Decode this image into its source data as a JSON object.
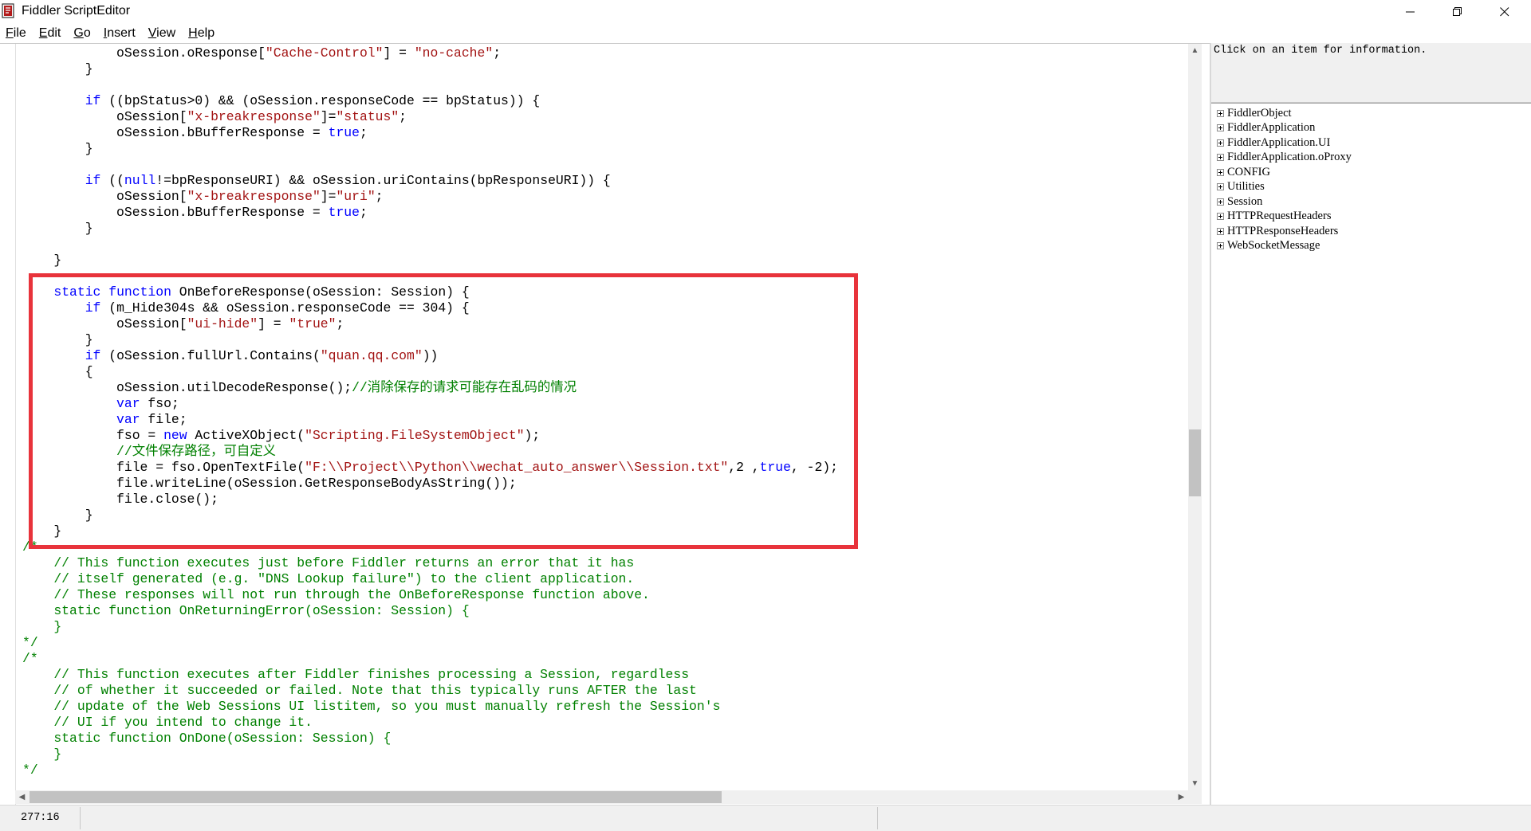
{
  "window": {
    "title": "Fiddler ScriptEditor",
    "minimize": "—",
    "maximize": "❐",
    "close": "✕"
  },
  "menu": [
    {
      "mnemonic": "F",
      "rest": "ile"
    },
    {
      "mnemonic": "E",
      "rest": "dit"
    },
    {
      "mnemonic": "G",
      "rest": "o"
    },
    {
      "mnemonic": "I",
      "rest": "nsert"
    },
    {
      "mnemonic": "V",
      "rest": "iew"
    },
    {
      "mnemonic": "H",
      "rest": "elp"
    }
  ],
  "editor": {
    "lines": [
      [
        [
          "            oSession.oResponse[",
          ""
        ],
        [
          "\"Cache-Control\"",
          "str"
        ],
        [
          "] = ",
          ""
        ],
        [
          "\"no-cache\"",
          "str"
        ],
        [
          ";",
          ""
        ]
      ],
      [
        [
          "        }",
          ""
        ]
      ],
      [
        [
          "",
          ""
        ]
      ],
      [
        [
          "        ",
          ""
        ],
        [
          "if",
          "kw"
        ],
        [
          " ((bpStatus>0) && (oSession.responseCode == bpStatus)) {",
          ""
        ]
      ],
      [
        [
          "            oSession[",
          ""
        ],
        [
          "\"x-breakresponse\"",
          "str"
        ],
        [
          "]=",
          ""
        ],
        [
          "\"status\"",
          "str"
        ],
        [
          ";",
          ""
        ]
      ],
      [
        [
          "            oSession.bBufferResponse = ",
          ""
        ],
        [
          "true",
          "kw"
        ],
        [
          ";",
          ""
        ]
      ],
      [
        [
          "        }",
          ""
        ]
      ],
      [
        [
          "",
          ""
        ]
      ],
      [
        [
          "        ",
          ""
        ],
        [
          "if",
          "kw"
        ],
        [
          " ((",
          ""
        ],
        [
          "null",
          "kw"
        ],
        [
          "!=bpResponseURI) && oSession.uriContains(bpResponseURI)) {",
          ""
        ]
      ],
      [
        [
          "            oSession[",
          ""
        ],
        [
          "\"x-breakresponse\"",
          "str"
        ],
        [
          "]=",
          ""
        ],
        [
          "\"uri\"",
          "str"
        ],
        [
          ";",
          ""
        ]
      ],
      [
        [
          "            oSession.bBufferResponse = ",
          ""
        ],
        [
          "true",
          "kw"
        ],
        [
          ";",
          ""
        ]
      ],
      [
        [
          "        }",
          ""
        ]
      ],
      [
        [
          "",
          ""
        ]
      ],
      [
        [
          "    }",
          ""
        ]
      ],
      [
        [
          "",
          ""
        ]
      ],
      [
        [
          "    ",
          ""
        ],
        [
          "static",
          "kw"
        ],
        [
          " ",
          ""
        ],
        [
          "function",
          "kw"
        ],
        [
          " OnBeforeResponse(oSession: Session) {",
          ""
        ]
      ],
      [
        [
          "        ",
          ""
        ],
        [
          "if",
          "kw"
        ],
        [
          " (m_Hide304s && oSession.responseCode == 304) {",
          ""
        ]
      ],
      [
        [
          "            oSession[",
          ""
        ],
        [
          "\"ui-hide\"",
          "str"
        ],
        [
          "] = ",
          ""
        ],
        [
          "\"true\"",
          "str"
        ],
        [
          ";",
          ""
        ]
      ],
      [
        [
          "        }",
          ""
        ]
      ],
      [
        [
          "        ",
          ""
        ],
        [
          "if",
          "kw"
        ],
        [
          " (oSession.fullUrl.Contains(",
          ""
        ],
        [
          "\"quan.qq.com\"",
          "str"
        ],
        [
          "))",
          ""
        ]
      ],
      [
        [
          "        {",
          ""
        ]
      ],
      [
        [
          "            oSession.utilDecodeResponse();",
          ""
        ],
        [
          "//消除保存的请求可能存在乱码的情况",
          "cm"
        ]
      ],
      [
        [
          "            ",
          ""
        ],
        [
          "var",
          "kw"
        ],
        [
          " fso;",
          ""
        ]
      ],
      [
        [
          "            ",
          ""
        ],
        [
          "var",
          "kw"
        ],
        [
          " file;",
          ""
        ]
      ],
      [
        [
          "            fso = ",
          ""
        ],
        [
          "new",
          "kw"
        ],
        [
          " ActiveXObject(",
          ""
        ],
        [
          "\"Scripting.FileSystemObject\"",
          "str"
        ],
        [
          ");",
          ""
        ]
      ],
      [
        [
          "            ",
          ""
        ],
        [
          "//文件保存路径，可自定义",
          "cm"
        ]
      ],
      [
        [
          "            file = fso.OpenTextFile(",
          ""
        ],
        [
          "\"F:\\\\Project\\\\Python\\\\wechat_auto_answer\\\\Session.txt\"",
          "str"
        ],
        [
          ",2 ,",
          ""
        ],
        [
          "true",
          "kw"
        ],
        [
          ", -2);",
          ""
        ]
      ],
      [
        [
          "            file.writeLine(oSession.GetResponseBodyAsString());",
          ""
        ]
      ],
      [
        [
          "            file.close();",
          ""
        ]
      ],
      [
        [
          "        }",
          ""
        ]
      ],
      [
        [
          "    }",
          ""
        ]
      ],
      [
        [
          "/*",
          "cm"
        ]
      ],
      [
        [
          "    // This function executes just before Fiddler returns an error that it has",
          "cm"
        ]
      ],
      [
        [
          "    // itself generated (e.g. \"DNS Lookup failure\") to the client application.",
          "cm"
        ]
      ],
      [
        [
          "    // These responses will not run through the OnBeforeResponse function above.",
          "cm"
        ]
      ],
      [
        [
          "    static function OnReturningError(oSession: Session) {",
          "cm"
        ]
      ],
      [
        [
          "    }",
          "cm"
        ]
      ],
      [
        [
          "*/",
          "cm"
        ]
      ],
      [
        [
          "/*",
          "cm"
        ]
      ],
      [
        [
          "    // This function executes after Fiddler finishes processing a Session, regardless",
          "cm"
        ]
      ],
      [
        [
          "    // of whether it succeeded or failed. Note that this typically runs AFTER the last",
          "cm"
        ]
      ],
      [
        [
          "    // update of the Web Sessions UI listitem, so you must manually refresh the Session's",
          "cm"
        ]
      ],
      [
        [
          "    // UI if you intend to change it.",
          "cm"
        ]
      ],
      [
        [
          "    static function OnDone(oSession: Session) {",
          "cm"
        ]
      ],
      [
        [
          "    }",
          "cm"
        ]
      ],
      [
        [
          "*/",
          "cm"
        ]
      ]
    ]
  },
  "info_panel": {
    "text": "Click on an item for information."
  },
  "tree": [
    "FiddlerObject",
    "FiddlerApplication",
    "FiddlerApplication.UI",
    "FiddlerApplication.oProxy",
    "CONFIG",
    "Utilities",
    "Session",
    "HTTPRequestHeaders",
    "HTTPResponseHeaders",
    "WebSocketMessage"
  ],
  "status": {
    "position": "277:16"
  },
  "icons": {
    "app": "fiddler-script-icon",
    "scroll_up": "▲",
    "scroll_down": "▼",
    "scroll_left": "◀",
    "scroll_right": "▶"
  },
  "colors": {
    "keyword": "#0000ff",
    "string": "#a31515",
    "comment": "#008000",
    "highlight_box": "#e8333b"
  }
}
